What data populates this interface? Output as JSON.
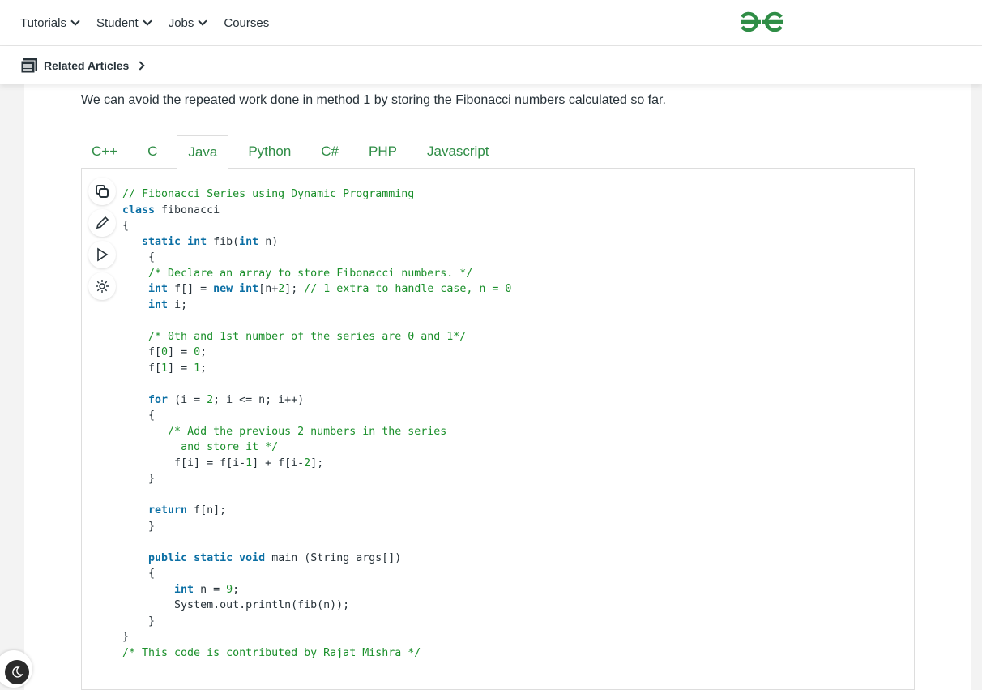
{
  "nav": {
    "items": [
      {
        "label": "Tutorials",
        "dropdown": true
      },
      {
        "label": "Student",
        "dropdown": true
      },
      {
        "label": "Jobs",
        "dropdown": true
      },
      {
        "label": "Courses",
        "dropdown": false
      }
    ],
    "logo": "GfG",
    "brand_color": "#2f8d46"
  },
  "subnav": {
    "label": "Related Articles"
  },
  "article": {
    "intro": "We can avoid the repeated work done in method 1 by storing the Fibonacci numbers calculated so far."
  },
  "tabs": [
    {
      "label": "C++"
    },
    {
      "label": "C"
    },
    {
      "label": "Java",
      "active": true
    },
    {
      "label": "Python"
    },
    {
      "label": "C#"
    },
    {
      "label": "PHP"
    },
    {
      "label": "Javascript"
    }
  ],
  "code_tools": [
    "copy-icon",
    "edit-icon",
    "run-icon",
    "theme-icon"
  ],
  "code": [
    [
      [
        "cm",
        "// Fibonacci Series using Dynamic Programming"
      ]
    ],
    [
      [
        "kw",
        "class"
      ],
      [
        "p",
        " fibonacci"
      ]
    ],
    [
      [
        "p",
        "{"
      ]
    ],
    [
      [
        "p",
        "   "
      ],
      [
        "kw",
        "static"
      ],
      [
        "p",
        " "
      ],
      [
        "kw",
        "int"
      ],
      [
        "p",
        " fib("
      ],
      [
        "kw",
        "int"
      ],
      [
        "p",
        " n)"
      ]
    ],
    [
      [
        "p",
        "    {"
      ]
    ],
    [
      [
        "p",
        "    "
      ],
      [
        "cm",
        "/* Declare an array to store Fibonacci numbers. */"
      ]
    ],
    [
      [
        "p",
        "    "
      ],
      [
        "kw",
        "int"
      ],
      [
        "p",
        " f[] = "
      ],
      [
        "kw",
        "new"
      ],
      [
        "p",
        " "
      ],
      [
        "kw",
        "int"
      ],
      [
        "p",
        "[n+"
      ],
      [
        "num",
        "2"
      ],
      [
        "p",
        "]; "
      ],
      [
        "cm",
        "// 1 extra to handle case, n = 0"
      ]
    ],
    [
      [
        "p",
        "    "
      ],
      [
        "kw",
        "int"
      ],
      [
        "p",
        " i;"
      ]
    ],
    [
      [
        "p",
        ""
      ]
    ],
    [
      [
        "p",
        "    "
      ],
      [
        "cm",
        "/* 0th and 1st number of the series are 0 and 1*/"
      ]
    ],
    [
      [
        "p",
        "    f["
      ],
      [
        "num",
        "0"
      ],
      [
        "p",
        "] = "
      ],
      [
        "num",
        "0"
      ],
      [
        "p",
        ";"
      ]
    ],
    [
      [
        "p",
        "    f["
      ],
      [
        "num",
        "1"
      ],
      [
        "p",
        "] = "
      ],
      [
        "num",
        "1"
      ],
      [
        "p",
        ";"
      ]
    ],
    [
      [
        "p",
        ""
      ]
    ],
    [
      [
        "p",
        "    "
      ],
      [
        "kw",
        "for"
      ],
      [
        "p",
        " (i = "
      ],
      [
        "num",
        "2"
      ],
      [
        "p",
        "; i <= n; i++)"
      ]
    ],
    [
      [
        "p",
        "    {"
      ]
    ],
    [
      [
        "p",
        "       "
      ],
      [
        "cm",
        "/* Add the previous 2 numbers in the series"
      ]
    ],
    [
      [
        "p",
        "         "
      ],
      [
        "cm",
        "and store it */"
      ]
    ],
    [
      [
        "p",
        "        f[i] = f[i-"
      ],
      [
        "num",
        "1"
      ],
      [
        "p",
        "] + f[i-"
      ],
      [
        "num",
        "2"
      ],
      [
        "p",
        "];"
      ]
    ],
    [
      [
        "p",
        "    }"
      ]
    ],
    [
      [
        "p",
        ""
      ]
    ],
    [
      [
        "p",
        "    "
      ],
      [
        "kw",
        "return"
      ],
      [
        "p",
        " f[n];"
      ]
    ],
    [
      [
        "p",
        "    }"
      ]
    ],
    [
      [
        "p",
        ""
      ]
    ],
    [
      [
        "p",
        "    "
      ],
      [
        "kw",
        "public"
      ],
      [
        "p",
        " "
      ],
      [
        "kw",
        "static"
      ],
      [
        "p",
        " "
      ],
      [
        "kw",
        "void"
      ],
      [
        "p",
        " main (String args[])"
      ]
    ],
    [
      [
        "p",
        "    {"
      ]
    ],
    [
      [
        "p",
        "        "
      ],
      [
        "kw",
        "int"
      ],
      [
        "p",
        " n = "
      ],
      [
        "num",
        "9"
      ],
      [
        "p",
        ";"
      ]
    ],
    [
      [
        "p",
        "        System.out.println(fib(n));"
      ]
    ],
    [
      [
        "p",
        "    }"
      ]
    ],
    [
      [
        "p",
        "}"
      ]
    ],
    [
      [
        "cm",
        "/* This code is contributed by Rajat Mishra */"
      ]
    ]
  ]
}
